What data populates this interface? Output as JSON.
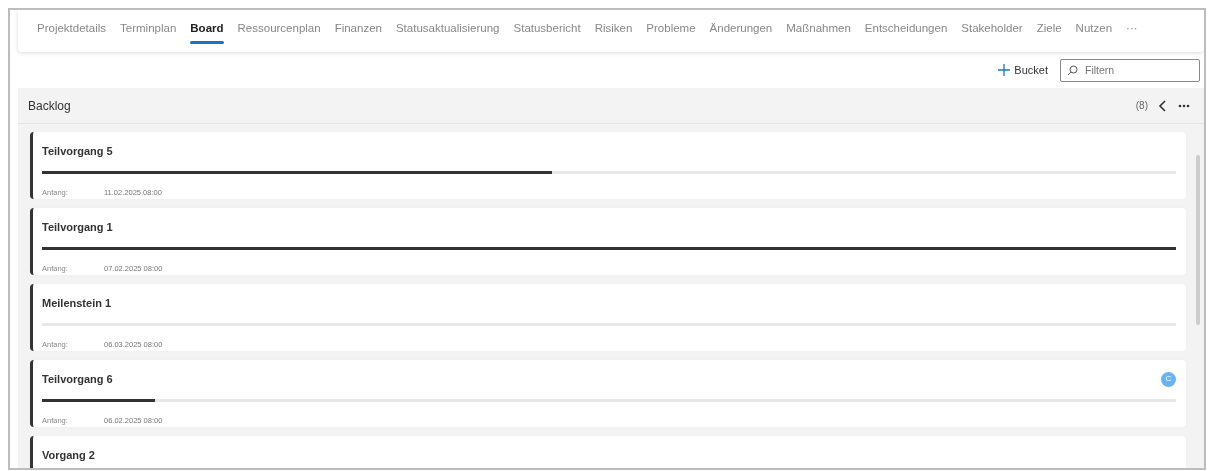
{
  "tabs": [
    {
      "label": "Projektdetails",
      "selected": false
    },
    {
      "label": "Terminplan",
      "selected": false
    },
    {
      "label": "Board",
      "selected": true
    },
    {
      "label": "Ressourcenplan",
      "selected": false
    },
    {
      "label": "Finanzen",
      "selected": false
    },
    {
      "label": "Statusaktualisierung",
      "selected": false
    },
    {
      "label": "Statusbericht",
      "selected": false
    },
    {
      "label": "Risiken",
      "selected": false
    },
    {
      "label": "Probleme",
      "selected": false
    },
    {
      "label": "Änderungen",
      "selected": false
    },
    {
      "label": "Maßnahmen",
      "selected": false
    },
    {
      "label": "Entscheidungen",
      "selected": false
    },
    {
      "label": "Stakeholder",
      "selected": false
    },
    {
      "label": "Ziele",
      "selected": false
    },
    {
      "label": "Nutzen",
      "selected": false
    },
    {
      "label": "···",
      "selected": false
    }
  ],
  "toolbar": {
    "add_bucket": "Bucket",
    "filter": {
      "placeholder": "Filtern"
    }
  },
  "bucket": {
    "title": "Backlog",
    "count": "(8)",
    "cards": [
      {
        "title": "Teilvorgang 5",
        "level": 0.45,
        "start_label": "Anfang:",
        "start": "11.02.2025 08:00"
      },
      {
        "title": "Teilvorgang 1",
        "level": 1,
        "start_label": "Anfang:",
        "start": "07.02.2025 08:00"
      },
      {
        "title": "Meilenstein 1",
        "level": 0,
        "start_label": "Anfang:",
        "start": "06.03.2025 08:00"
      },
      {
        "title": "Teilvorgang 6",
        "level": 0.1,
        "start_label": "Anfang:",
        "start": "06.02.2025 08:00",
        "avatar": "C"
      },
      {
        "title": "Vorgang 2"
      }
    ]
  }
}
